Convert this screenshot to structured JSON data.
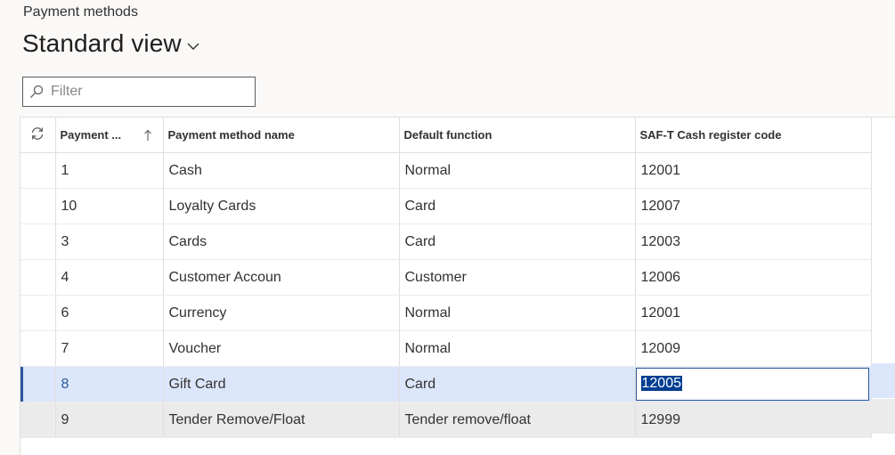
{
  "breadcrumb": "Payment methods",
  "view": {
    "title": "Standard view"
  },
  "filter": {
    "placeholder": "Filter"
  },
  "table": {
    "columns": [
      "Payment ...",
      "Payment method name",
      "Default function",
      "SAF-T Cash register code"
    ],
    "rows": [
      {
        "id": "1",
        "name": "Cash",
        "function": "Normal",
        "code": "12001"
      },
      {
        "id": "10",
        "name": "Loyalty Cards",
        "function": "Card",
        "code": "12007"
      },
      {
        "id": "3",
        "name": "Cards",
        "function": "Card",
        "code": "12003"
      },
      {
        "id": "4",
        "name": "Customer Accoun",
        "function": "Customer",
        "code": "12006"
      },
      {
        "id": "6",
        "name": "Currency",
        "function": "Normal",
        "code": "12001"
      },
      {
        "id": "7",
        "name": "Voucher",
        "function": "Normal",
        "code": "12009"
      },
      {
        "id": "8",
        "name": "Gift Card",
        "function": "Card",
        "code": "12005"
      },
      {
        "id": "9",
        "name": "Tender Remove/Float",
        "function": "Tender remove/float",
        "code": "12999"
      }
    ]
  },
  "colors": {
    "accent": "#2b579a",
    "selected_row": "#dce6fb",
    "highlight": "#003e92"
  }
}
